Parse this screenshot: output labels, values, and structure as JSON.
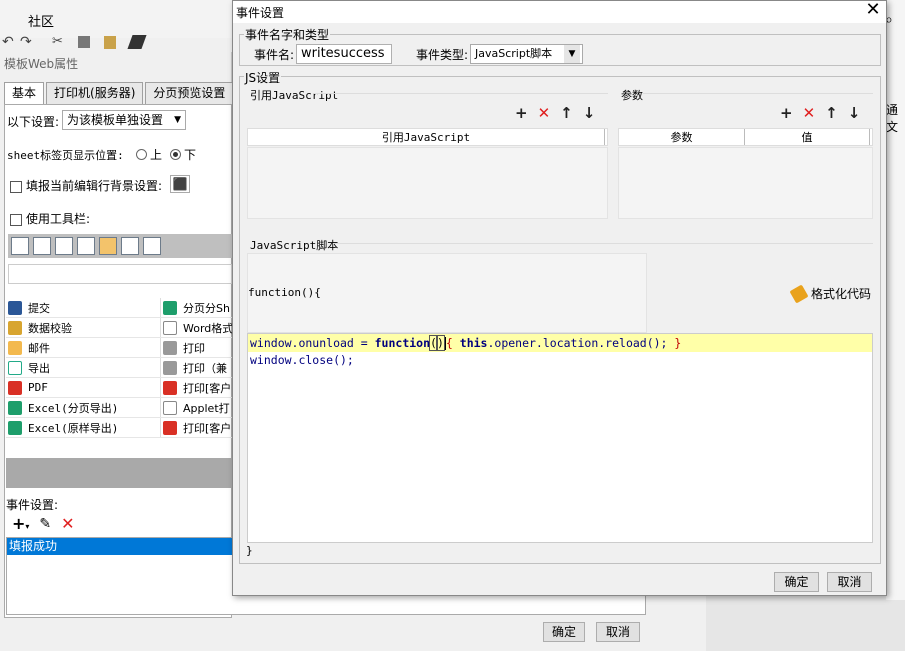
{
  "background": {
    "top_tab": "社区",
    "panel_title": "模板Web属性",
    "tabs": [
      "基本",
      "打印机(服务器)",
      "分页预览设置"
    ],
    "setting_label": "以下设置:",
    "setting_value": "为该模板单独设置",
    "sheet_label": "sheet标签页显示位置:",
    "sheet_top": "上",
    "sheet_bottom": "下",
    "fill_bg_label": "填报当前编辑行背景设置:",
    "use_toolbar_label": "使用工具栏:",
    "buttons_left": [
      "提交",
      "数据校验",
      "邮件",
      "导出",
      "PDF",
      "Excel(分页导出)",
      "Excel(原样导出)"
    ],
    "buttons_right": [
      "分页分Sh",
      "Word格式",
      "打印",
      "打印（兼",
      "打印[客户",
      "Applet打",
      "打印[客户"
    ],
    "event_label": "事件设置:",
    "event_items": [
      "填报成功"
    ],
    "ok": "确定",
    "cancel": "取消",
    "right_text": "通文"
  },
  "dialog": {
    "title": "事件设置",
    "close": "✕",
    "name_group": "事件名字和类型",
    "event_name_label": "事件名:",
    "event_name_value": "writesuccess",
    "event_type_label": "事件类型:",
    "event_type_value": "JavaScript脚本",
    "js_group": "JS设置",
    "ref_js_label": "引用JavaScript",
    "params_label": "参数",
    "ref_js_col": "引用JavaScript",
    "params_cols": [
      "参数",
      "值"
    ],
    "js_script_label": "JavaScript脚本",
    "function_open": "function(){",
    "format_code": "格式化代码",
    "code_line1": {
      "part1": "window.onunload = ",
      "kw_function": "function",
      "paren_open": "(",
      "paren_close": ")",
      "brace_open": "{",
      "kw_this": "this",
      "part2": ".opener.location.reload(); ",
      "brace_close": "}"
    },
    "code_line2": "window.close();",
    "function_close": "}",
    "ok": "确定",
    "cancel": "取消"
  },
  "colors": {
    "selection": "#0078d7",
    "keyword": "#00007f",
    "brace": "#c00000",
    "highlight_line": "#ffffa8",
    "delete_icon": "#e02020"
  }
}
